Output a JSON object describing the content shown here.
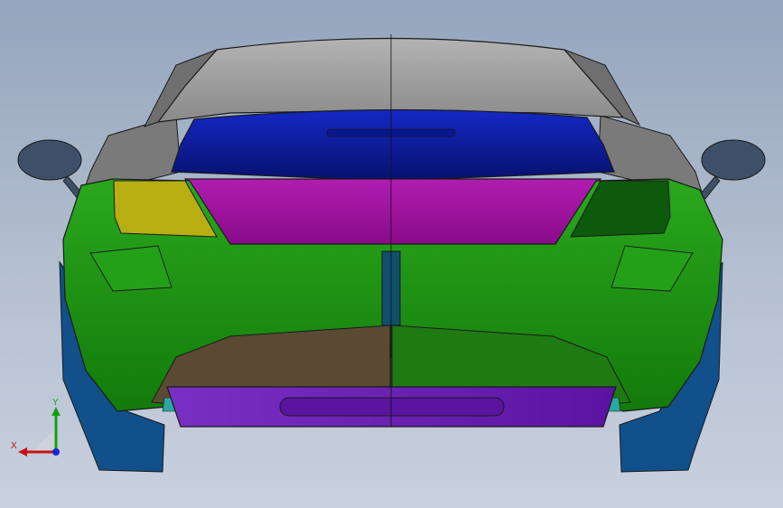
{
  "viewport": {
    "background_top": "#94a5bd",
    "background_bottom": "#c9d0de"
  },
  "model": {
    "subject": "car-rear-view",
    "colors": {
      "glass": "#9a9a9a",
      "glass_dark": "#6f6f6f",
      "outline": "#1a1a1a",
      "spoiler": "#0a1ca8",
      "spoiler_dark": "#08137a",
      "trunk_panel": "#8e0c8e",
      "trunk_panel_light": "#b21ab2",
      "bumper": "#1e8a14",
      "bumper_light": "#2db31f",
      "lamp_left": "#b8ae12",
      "lamp_right": "#0d5a0d",
      "diffuser_left": "#5a4a33",
      "diffuser_right": "#1f7a14",
      "lower_valance": "#6a1fb0",
      "side_skirt": "#11508a",
      "mirror": "#3e5068",
      "reflector": "#2aa7a0",
      "plate_slot": "#114f6a"
    }
  },
  "triad": {
    "x_label": "X",
    "y_label": "Y",
    "x_color": "#c81414",
    "y_color": "#14a014",
    "z_color": "#1428d2"
  }
}
